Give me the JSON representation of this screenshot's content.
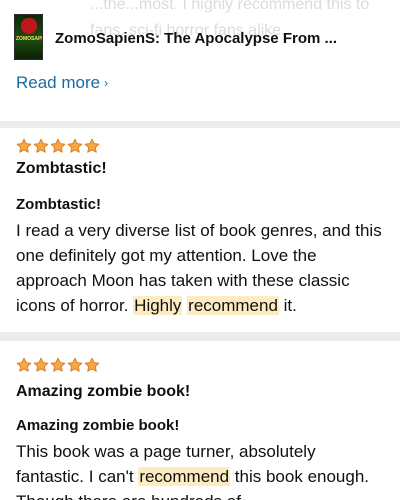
{
  "header": {
    "ghost_text": "...the...most. I highly recommend this to fans, sci-fi horror fans alike.",
    "product_title": "ZomoSapienS: The Apocalypse From ...",
    "thumbnail_text": "ZOMOSAPIENS",
    "read_more_label": "Read more",
    "read_more_icon": "chevron-right-icon"
  },
  "reviews": [
    {
      "rating": 5,
      "max_rating": 5,
      "title": "Zombtastic!",
      "subtitle": "Zombtastic!",
      "body_parts": [
        {
          "text": "I read a very diverse list of book genres, and this one definitely got my attention. Love the approach Moon has taken with these classic icons of horror. ",
          "highlight": false
        },
        {
          "text": "Highly",
          "highlight": true
        },
        {
          "text": " ",
          "highlight": false
        },
        {
          "text": "recommend",
          "highlight": true
        },
        {
          "text": " it.",
          "highlight": false
        }
      ]
    },
    {
      "rating": 5,
      "max_rating": 5,
      "title": "Amazing zombie book!",
      "subtitle": "Amazing zombie book!",
      "body_parts": [
        {
          "text": "This book was a page turner, absolutely fantastic. I can't ",
          "highlight": false
        },
        {
          "text": "recommend",
          "highlight": true
        },
        {
          "text": " this book enough. Though there are hundreds of",
          "highlight": false
        }
      ]
    }
  ],
  "colors": {
    "star": "#f3a847",
    "star_outline": "#de7921",
    "link": "#1a6ba4",
    "highlight": "#fdecc1",
    "background": "#ececec"
  }
}
